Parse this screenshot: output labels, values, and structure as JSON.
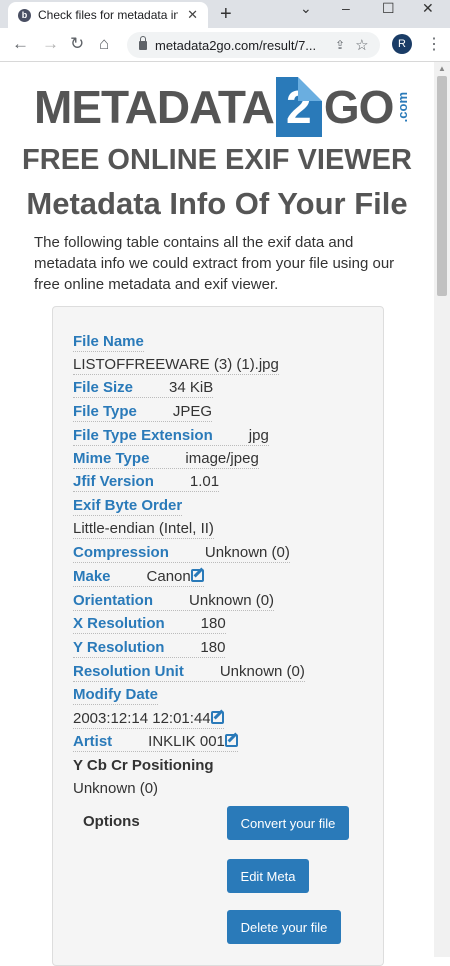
{
  "browser": {
    "tab_title": "Check files for metadata info",
    "tab_favicon": "b",
    "url": "metadata2go.com/result/7...",
    "profile_initial": "R"
  },
  "logo": {
    "left": "METADATA",
    "two": "2",
    "right": "GO",
    "com": ".com"
  },
  "heading": "FREE ONLINE EXIF VIEWER",
  "subheading": "Metadata Info Of Your File",
  "intro": "The following table contains all the exif data and metadata info we could extract from your file using our free online metadata and exif viewer.",
  "fields": {
    "file_name": {
      "label": "File Name",
      "value": "LISTOFFREEWARE (3) (1).jpg"
    },
    "file_size": {
      "label": "File Size",
      "value": "34 KiB"
    },
    "file_type": {
      "label": "File Type",
      "value": "JPEG"
    },
    "file_type_ext": {
      "label": "File Type Extension",
      "value": "jpg"
    },
    "mime_type": {
      "label": "Mime Type",
      "value": "image/jpeg"
    },
    "jfif_version": {
      "label": "Jfif Version",
      "value": "1.01"
    },
    "exif_byte_order": {
      "label": "Exif Byte Order",
      "value": "Little-endian (Intel, II)"
    },
    "compression": {
      "label": "Compression",
      "value": "Unknown (0)"
    },
    "make": {
      "label": "Make",
      "value": "Canon"
    },
    "orientation": {
      "label": "Orientation",
      "value": "Unknown (0)"
    },
    "x_resolution": {
      "label": "X Resolution",
      "value": "180"
    },
    "y_resolution": {
      "label": "Y Resolution",
      "value": "180"
    },
    "resolution_unit": {
      "label": "Resolution Unit",
      "value": "Unknown (0)"
    },
    "modify_date": {
      "label": "Modify Date",
      "value": "2003:12:14 12:01:44"
    },
    "artist": {
      "label": "Artist",
      "value": "INKLIK 001"
    },
    "ycbcr": {
      "label": "Y Cb Cr Positioning",
      "value": "Unknown (0)"
    }
  },
  "options": {
    "label": "Options",
    "convert": "Convert your file",
    "edit": "Edit Meta",
    "delete": "Delete your file"
  },
  "colors": {
    "accent": "#2a7ab9",
    "heading": "#555555"
  }
}
